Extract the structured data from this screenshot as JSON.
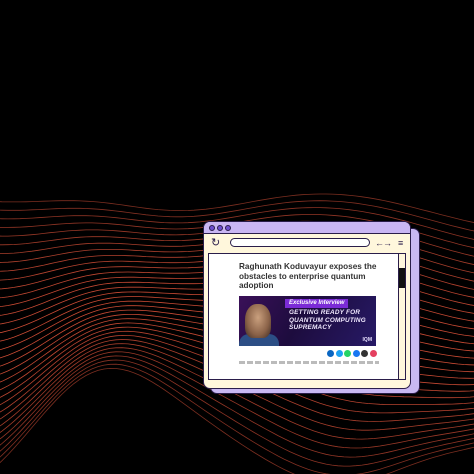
{
  "background": {
    "color": "#000000",
    "wave_color": "#e0533a"
  },
  "browser": {
    "frame_color": "#fff7dc",
    "titlebar_color": "#c9b6f3",
    "accent_color": "#6e4fcf",
    "reload_icon": "↻",
    "nav_icon": "←→",
    "menu_icon": "≡"
  },
  "article": {
    "title": "Raghunath Koduvayur exposes the obstacles to enterprise quantum adoption",
    "image": {
      "badge": "Exclusive Interview",
      "headline": "GETTING READY FOR QUANTUM COMPUTING SUPREMACY",
      "brand": "IQM"
    },
    "share_colors": [
      "#0a66c2",
      "#1da1f2",
      "#25d366",
      "#1877f2",
      "#333333",
      "#e4405f"
    ]
  }
}
